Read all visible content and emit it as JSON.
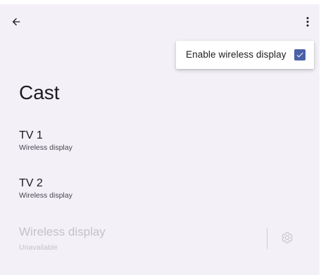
{
  "toolbar": {
    "back_icon": "arrow-back-icon",
    "more_icon": "more-vert-icon"
  },
  "menu": {
    "item_label": "Enable wireless display",
    "checked": true,
    "check_color": "#4a61a8"
  },
  "page": {
    "title": "Cast"
  },
  "devices": [
    {
      "name": "TV 1",
      "subtitle": "Wireless display"
    },
    {
      "name": "TV 2",
      "subtitle": "Wireless display"
    }
  ],
  "unavailable_item": {
    "name": "Wireless display",
    "subtitle": "Unavailable",
    "settings_icon": "gear-icon"
  },
  "colors": {
    "background": "#f3f1f7",
    "text_primary": "#1d1b20",
    "text_disabled": "#c4c2c8"
  }
}
